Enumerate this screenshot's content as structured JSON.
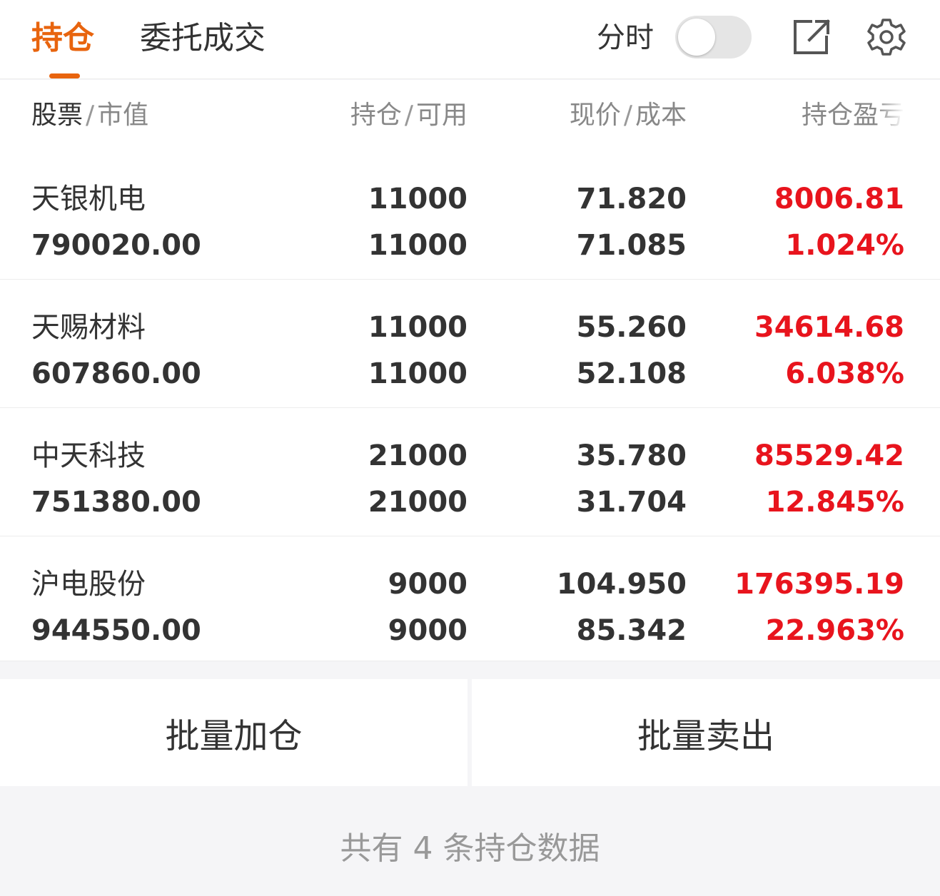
{
  "tabs": {
    "holdings": "持仓",
    "orders": "委托成交"
  },
  "toolbar": {
    "timeshare_label": "分时",
    "timeshare_on": false,
    "share_icon": "external-link-icon",
    "settings_icon": "gear-icon"
  },
  "columns": {
    "stock": "股票",
    "market_value": "市值",
    "position": "持仓",
    "available": "可用",
    "price": "现价",
    "cost": "成本",
    "pl": "持仓盈亏"
  },
  "rows": [
    {
      "name": "天银机电",
      "market_value": "790020.00",
      "position": "11000",
      "available": "11000",
      "price": "71.820",
      "cost": "71.085",
      "pl": "8006.81",
      "pl_pct": "1.024%"
    },
    {
      "name": "天赐材料",
      "market_value": "607860.00",
      "position": "11000",
      "available": "11000",
      "price": "55.260",
      "cost": "52.108",
      "pl": "34614.68",
      "pl_pct": "6.038%"
    },
    {
      "name": "中天科技",
      "market_value": "751380.00",
      "position": "21000",
      "available": "21000",
      "price": "35.780",
      "cost": "31.704",
      "pl": "85529.42",
      "pl_pct": "12.845%"
    },
    {
      "name": "沪电股份",
      "market_value": "944550.00",
      "position": "9000",
      "available": "9000",
      "price": "104.950",
      "cost": "85.342",
      "pl": "176395.19",
      "pl_pct": "22.963%"
    }
  ],
  "actions": {
    "batch_add": "批量加仓",
    "batch_sell": "批量卖出"
  },
  "footer": {
    "summary": "共有 4 条持仓数据"
  },
  "colors": {
    "accent": "#e8640e",
    "profit": "#e8141d"
  }
}
